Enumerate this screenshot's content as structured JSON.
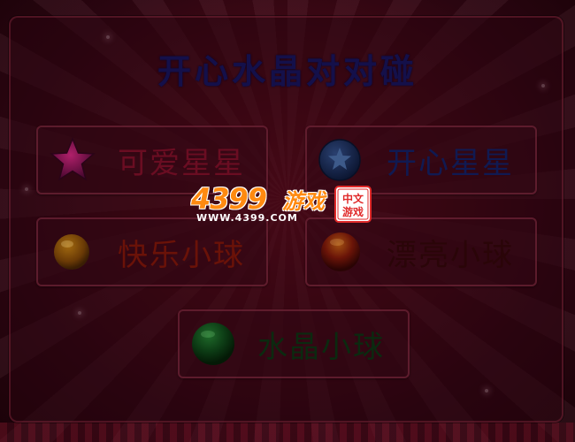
{
  "title": "开心水晶对对碰",
  "buttons": {
    "cute_stars": {
      "label": "可爱星星",
      "icon": "pink-star-icon"
    },
    "happy_stars": {
      "label": "开心星星",
      "icon": "blue-star-badge-icon"
    },
    "joy_balls": {
      "label": "快乐小球",
      "icon": "orange-ball-icon"
    },
    "pretty_balls": {
      "label": "漂亮小球",
      "icon": "red-ball-icon"
    },
    "crystal_balls": {
      "label": "水晶小球",
      "icon": "green-ball-icon"
    }
  },
  "logo": {
    "number": "4399",
    "game_text": "游戏",
    "url": "WWW.4399.COM",
    "seal_text": "中文游戏"
  },
  "colors": {
    "background": "#4a0a17",
    "title": "#14104a",
    "logo_orange": "#ff8a10"
  }
}
